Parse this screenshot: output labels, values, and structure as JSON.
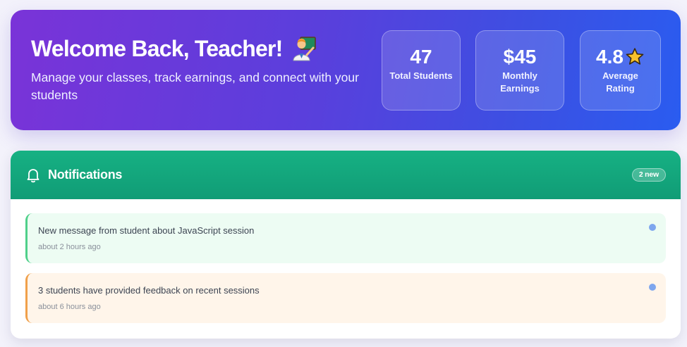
{
  "hero": {
    "title": "Welcome Back, Teacher!",
    "subtitle": "Manage your classes, track earnings, and connect with your students",
    "icon": "teacher-icon",
    "stats": [
      {
        "value": "47",
        "label": "Total Students"
      },
      {
        "value": "$45",
        "label": "Monthly Earnings"
      },
      {
        "value": "4.8",
        "label": "Average Rating",
        "icon": "star-icon"
      }
    ],
    "gradient": [
      "#7a33d8",
      "#2a5cf0"
    ]
  },
  "notifications": {
    "title": "Notifications",
    "icon": "bell-icon",
    "badge": "2 new",
    "accent": "#16b183",
    "items": [
      {
        "message": "New message from student about JavaScript session",
        "time": "about 2 hours ago",
        "accent": "#4fd08a",
        "unread": true
      },
      {
        "message": "3 students have provided feedback on recent sessions",
        "time": "about 6 hours ago",
        "accent": "#f0a04a",
        "unread": true
      }
    ]
  }
}
